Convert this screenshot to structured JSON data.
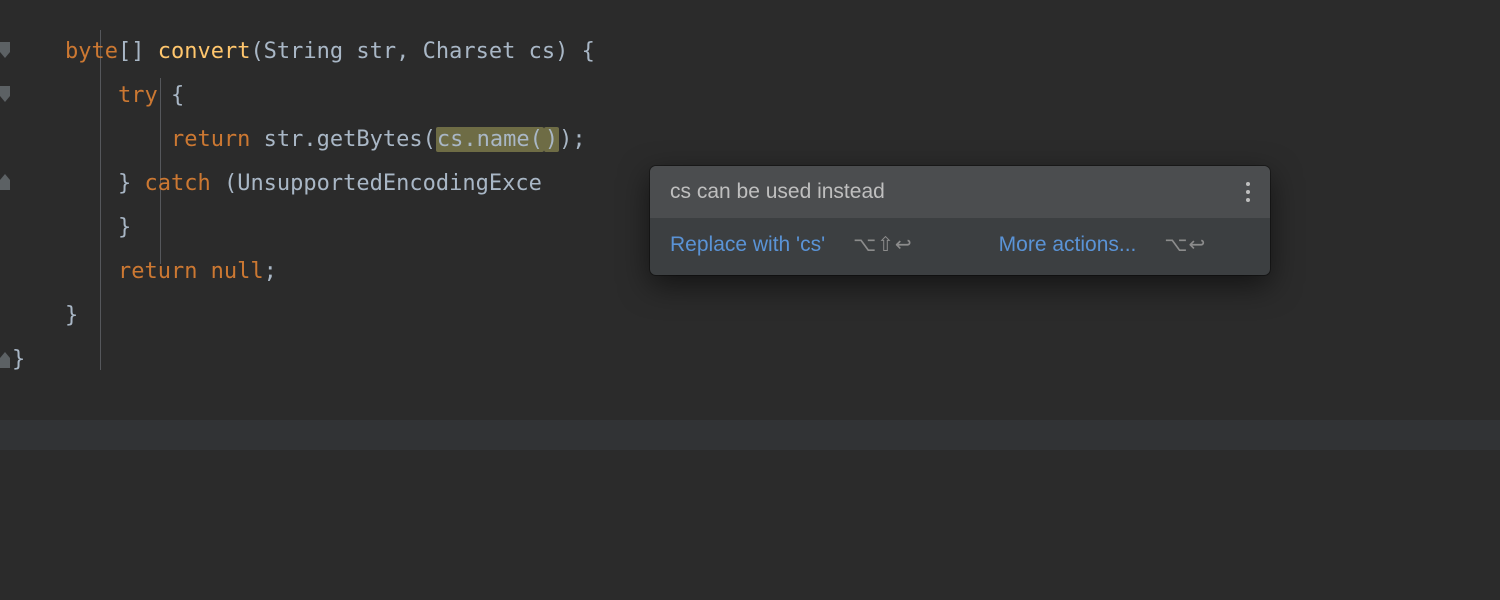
{
  "code": {
    "line1": {
      "t0": "    ",
      "kw1": "byte",
      "br": "[] ",
      "fn": "convert",
      "rest": "(String str, Charset cs) {"
    },
    "line2": {
      "indent": "        ",
      "kw": "try",
      "rest": " {"
    },
    "line3": {
      "indent": "            ",
      "kw": "return",
      "pre": " str.getBytes(",
      "hl1": "cs.name(",
      "hl2": ")",
      "post": ");"
    },
    "line4": {
      "indent": "        ",
      "close": "} ",
      "kw": "catch",
      "rest": " (UnsupportedEncodingExce"
    },
    "line5": {
      "indent": "",
      "text": ""
    },
    "line6": {
      "indent": "        ",
      "text": "}"
    },
    "line7": {
      "indent": "        ",
      "kw": "return null",
      "semi": ";"
    },
    "line8": {
      "indent": "    ",
      "text": "}"
    },
    "line9": {
      "indent": "",
      "text": "}"
    }
  },
  "popup": {
    "title": "cs can be used instead",
    "primary_action": "Replace with 'cs'",
    "primary_shortcut": "⌥⇧↩",
    "secondary_action": "More actions...",
    "secondary_shortcut": "⌥↩"
  }
}
